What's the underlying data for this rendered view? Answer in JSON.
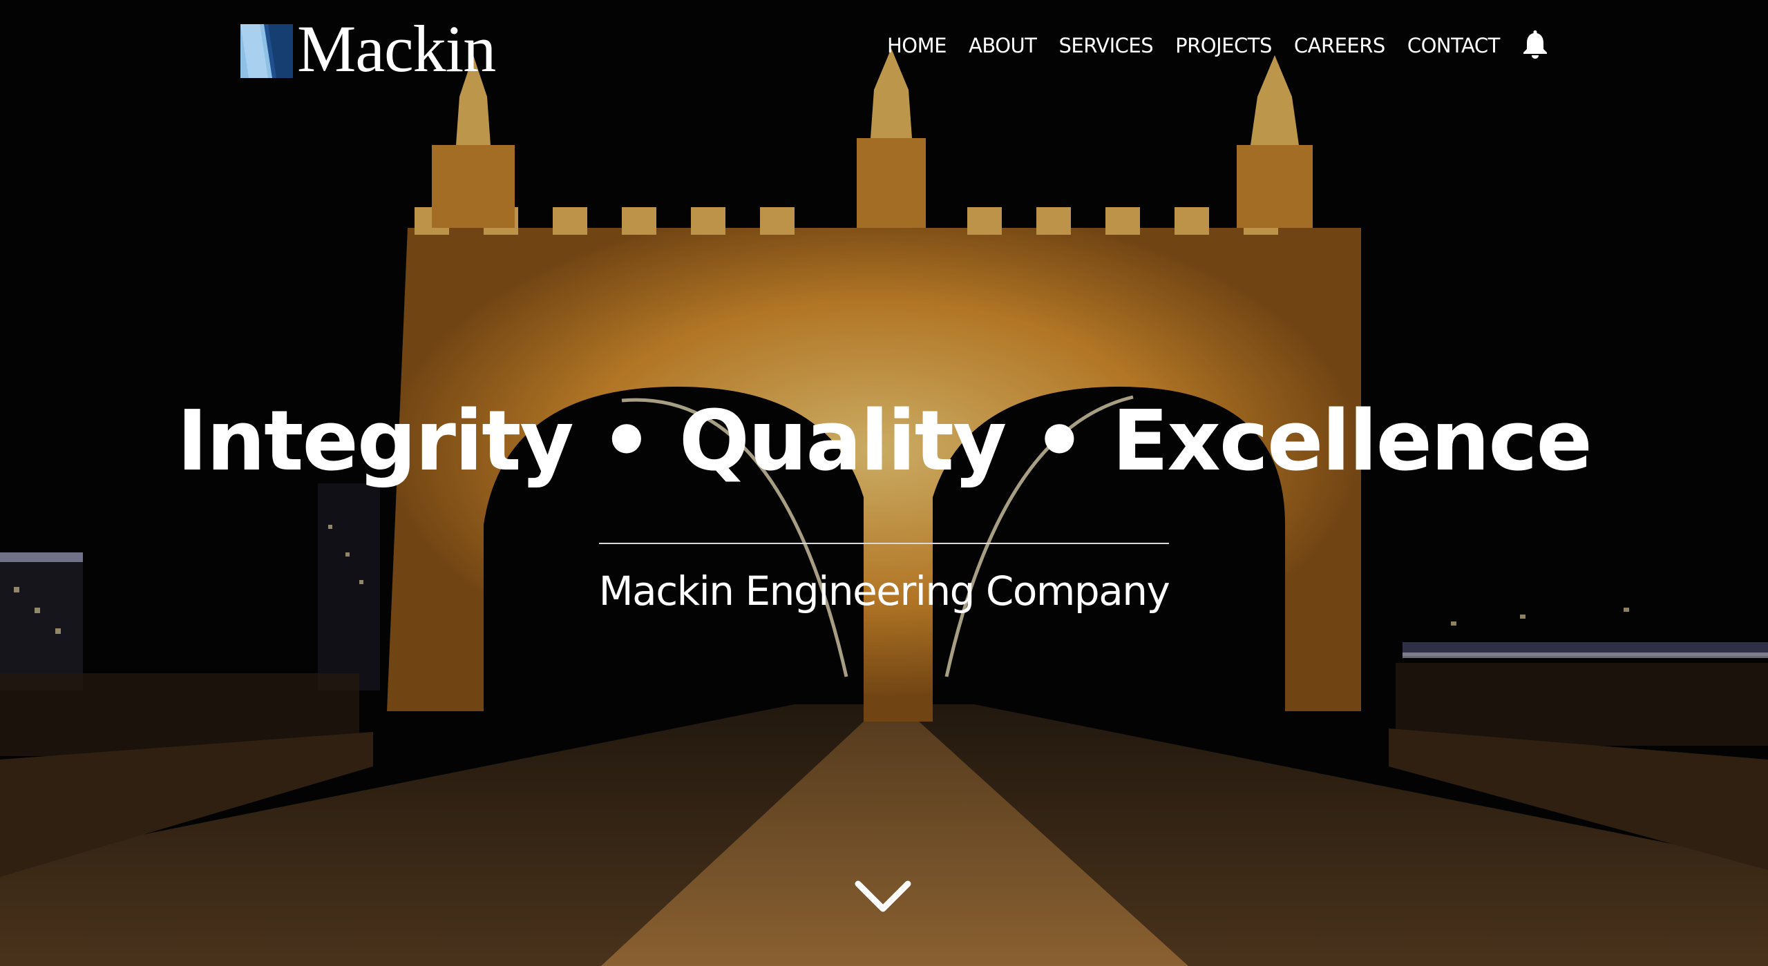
{
  "brand": {
    "name": "Mackin"
  },
  "nav": {
    "items": [
      {
        "label": "HOME"
      },
      {
        "label": "ABOUT"
      },
      {
        "label": "SERVICES"
      },
      {
        "label": "PROJECTS"
      },
      {
        "label": "CAREERS"
      },
      {
        "label": "CONTACT"
      }
    ],
    "notification_icon": "bell-icon"
  },
  "hero": {
    "headline": "Integrity • Quality • Excellence",
    "subtitle": "Mackin Engineering Company",
    "background_image": "night-bridge-photo",
    "scroll_icon": "chevron-down-icon"
  },
  "colors": {
    "logo_light_blue": "#8fc0e6",
    "logo_dark_blue": "#1f4f8c",
    "text": "#ffffff",
    "bridge_glow": "#e8a63c"
  }
}
